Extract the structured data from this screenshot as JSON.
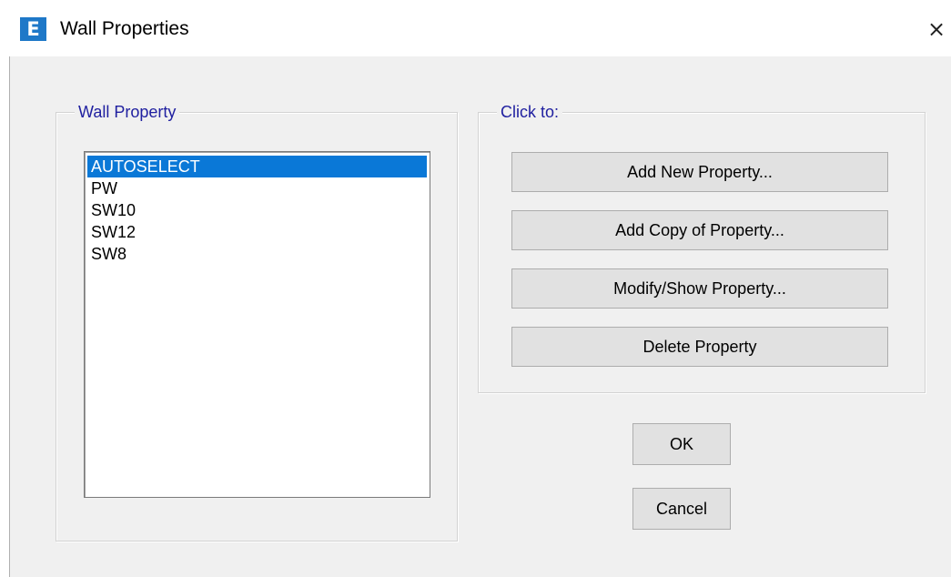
{
  "window": {
    "title": "Wall Properties",
    "app_icon_letter": "E",
    "close_glyph": "×"
  },
  "wall_property": {
    "group_label": "Wall Property",
    "items": [
      {
        "label": "AUTOSELECT",
        "selected": true
      },
      {
        "label": "PW",
        "selected": false
      },
      {
        "label": "SW10",
        "selected": false
      },
      {
        "label": "SW12",
        "selected": false
      },
      {
        "label": "SW8",
        "selected": false
      }
    ]
  },
  "click_to": {
    "group_label": "Click to:",
    "buttons": [
      {
        "label": "Add New Property..."
      },
      {
        "label": "Add Copy of Property..."
      },
      {
        "label": "Modify/Show Property..."
      },
      {
        "label": "Delete Property"
      }
    ]
  },
  "dialog_buttons": {
    "ok": "OK",
    "cancel": "Cancel"
  },
  "colors": {
    "selection": "#0a78d7",
    "group_label": "#2020a0",
    "app_icon": "#1e78c8"
  }
}
